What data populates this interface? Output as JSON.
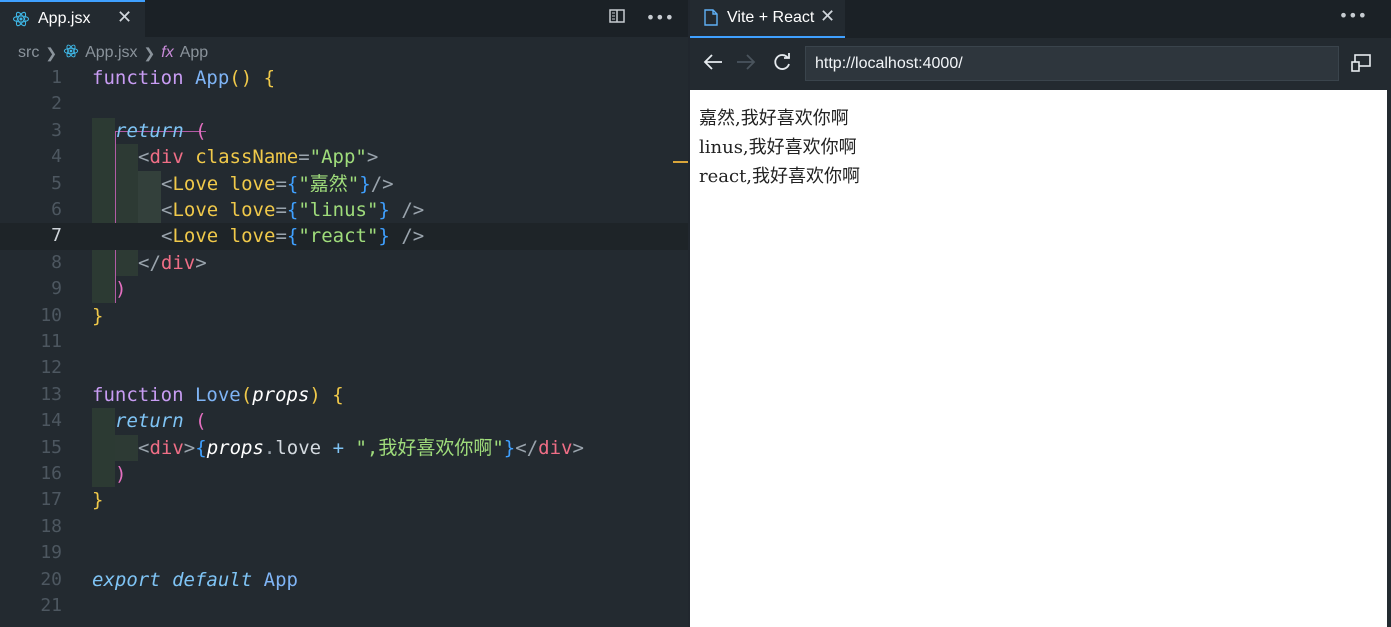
{
  "editor": {
    "tab": {
      "label": "App.jsx",
      "close": "✕",
      "icon": "react-icon"
    },
    "actions": {
      "split": "split-editor-icon",
      "more": "more-icon"
    },
    "breadcrumb": {
      "folder": "src",
      "file": "App.jsx",
      "symbol_prefix": "fx",
      "symbol": "App"
    },
    "lines": [
      "1",
      "2",
      "3",
      "4",
      "5",
      "6",
      "7",
      "8",
      "9",
      "10",
      "11",
      "12",
      "13",
      "14",
      "15",
      "16",
      "17",
      "18",
      "19",
      "20",
      "21"
    ],
    "code": {
      "l1": {
        "kw": "function",
        "name": "App",
        "paren": "()",
        "brace": "{"
      },
      "l3": {
        "kw": "return",
        "paren": "("
      },
      "l4": {
        "open": "<",
        "tag": "div",
        "attr": "className",
        "eq": "=",
        "val": "\"App\"",
        "close": ">"
      },
      "l5": {
        "open": "<",
        "comp": "Love",
        "attr": "love",
        "eq": "=",
        "lb": "{",
        "val": "\"嘉然\"",
        "rb": "}",
        "end": "/>"
      },
      "l6": {
        "open": "<",
        "comp": "Love",
        "attr": "love",
        "eq": "=",
        "lb": "{",
        "val": "\"linus\"",
        "rb": "}",
        "end": "/>"
      },
      "l7": {
        "open": "<",
        "comp": "Love",
        "attr": "love",
        "eq": "=",
        "lb": "{",
        "val": "\"react\"",
        "rb": "}",
        "end": "/>"
      },
      "l8": {
        "open": "</",
        "tag": "div",
        "close": ">"
      },
      "l9": {
        "paren": ")"
      },
      "l10": {
        "brace": "}"
      },
      "l13": {
        "kw": "function",
        "name": "Love",
        "lp": "(",
        "param": "props",
        "rp": ")",
        "brace": "{"
      },
      "l14": {
        "kw": "return",
        "paren": "("
      },
      "l15": {
        "open": "<",
        "tag": "div",
        "close": ">",
        "lb": "{",
        "param": "props",
        "dot": ".",
        "prop": "love",
        "plus": "+",
        "str": "\",我好喜欢你啊\"",
        "rb": "}",
        "endopen": "</",
        "endtag": "div",
        "endclose": ">"
      },
      "l16": {
        "paren": ")"
      },
      "l17": {
        "brace": "}"
      },
      "l20": {
        "kw1": "export",
        "kw2": "default",
        "name": "App"
      }
    }
  },
  "browser": {
    "tab": {
      "label": "Vite + React",
      "close": "✕",
      "icon": "document-icon"
    },
    "more": "more-icon",
    "nav": {
      "back": "back-arrow-icon",
      "forward": "forward-arrow-icon",
      "reload": "reload-icon",
      "cast": "cast-icon"
    },
    "url": "http://localhost:4000/",
    "content": [
      "嘉然,我好喜欢你啊",
      "linus,我好喜欢你啊",
      "react,我好喜欢你啊"
    ]
  }
}
